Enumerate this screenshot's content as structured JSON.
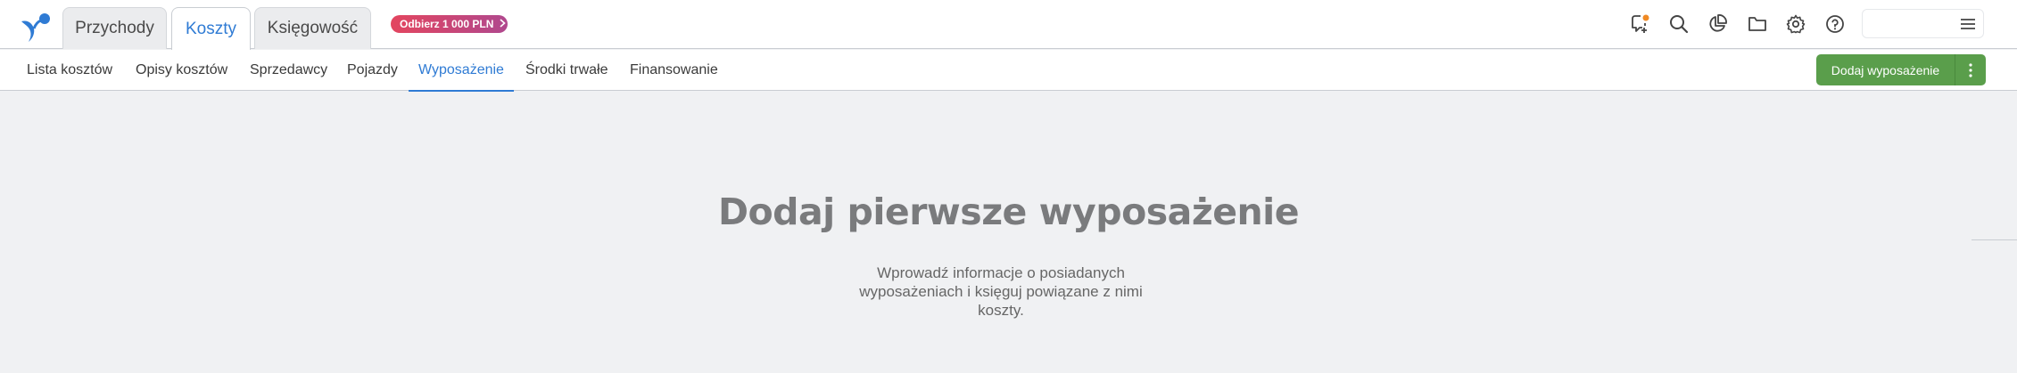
{
  "header": {
    "tabs": [
      {
        "label": "Przychody"
      },
      {
        "label": "Koszty"
      },
      {
        "label": "Księgowość"
      }
    ],
    "promo": {
      "label": "Odbierz 1 000 PLN"
    },
    "icons": [
      "notifications-icon",
      "search-icon",
      "reports-icon",
      "folder-icon",
      "settings-icon",
      "help-icon"
    ]
  },
  "subnav": {
    "items": [
      {
        "label": "Lista kosztów"
      },
      {
        "label": "Opisy kosztów"
      },
      {
        "label": "Sprzedawcy"
      },
      {
        "label": "Pojazdy"
      },
      {
        "label": "Wyposażenie"
      },
      {
        "label": "Środki trwałe"
      },
      {
        "label": "Finansowanie"
      }
    ],
    "add_button_label": "Dodaj wyposażenie"
  },
  "empty_state": {
    "title": "Dodaj pierwsze wyposażenie",
    "description": "Wprowadź informacje o posiadanych wyposażeniach i księguj powiązane z nimi koszty."
  },
  "colors": {
    "accent": "#2f7bd4",
    "primary_button": "#5a9e4b",
    "notification_dot": "#f08a24",
    "promo_start": "#e3455f",
    "promo_end": "#b0488e"
  }
}
